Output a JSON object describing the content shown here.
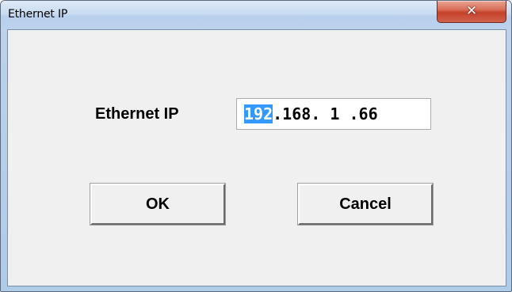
{
  "window": {
    "title": "Ethernet IP",
    "close_icon": "close-icon"
  },
  "form": {
    "label": "Ethernet IP",
    "ip_value": {
      "seg1": "192",
      "sep1": ".",
      "seg2": "168",
      "sep2": ". ",
      "seg3": "1",
      "sep3": " .",
      "seg4": "66"
    }
  },
  "buttons": {
    "ok_label": "OK",
    "cancel_label": "Cancel"
  },
  "colors": {
    "selection": "#3399ff",
    "close_button": "#c4412a",
    "dialog_face": "#f0f0f0"
  }
}
